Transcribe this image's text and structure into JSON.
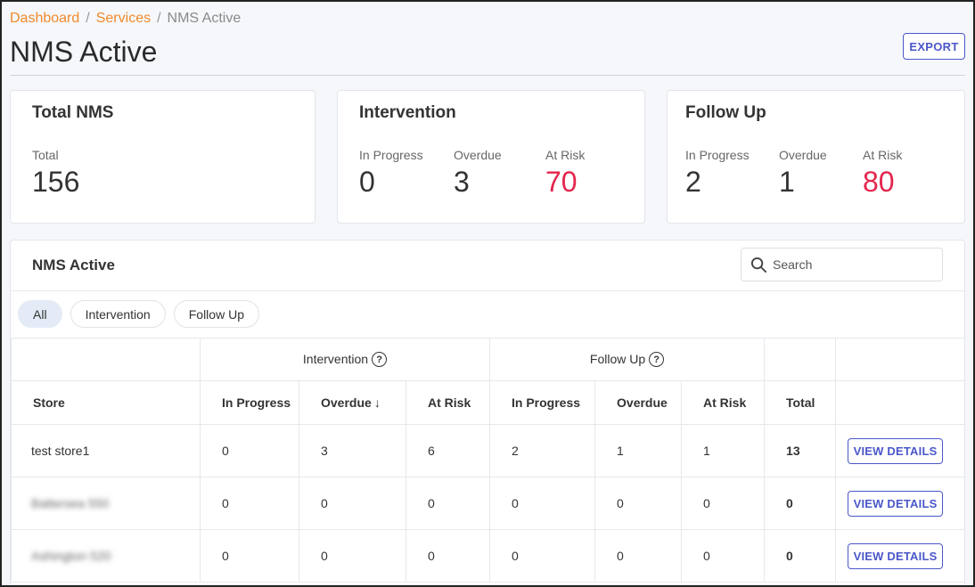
{
  "breadcrumb": {
    "dashboard": "Dashboard",
    "services": "Services",
    "current": "NMS Active",
    "separator": "/"
  },
  "page_title": "NMS Active",
  "export_label": "EXPORT",
  "cards": {
    "total": {
      "title": "Total NMS",
      "label": "Total",
      "value": "156"
    },
    "intervention": {
      "title": "Intervention",
      "in_progress_label": "In Progress",
      "in_progress": "0",
      "overdue_label": "Overdue",
      "overdue": "3",
      "at_risk_label": "At Risk",
      "at_risk": "70"
    },
    "follow_up": {
      "title": "Follow Up",
      "in_progress_label": "In Progress",
      "in_progress": "2",
      "overdue_label": "Overdue",
      "overdue": "1",
      "at_risk_label": "At Risk",
      "at_risk": "80"
    }
  },
  "panel": {
    "title": "NMS Active",
    "search_placeholder": "Search",
    "chips": [
      "All",
      "Intervention",
      "Follow Up"
    ],
    "active_chip": "All"
  },
  "table": {
    "groups": {
      "intervention": "Intervention",
      "follow_up": "Follow Up"
    },
    "columns": {
      "store": "Store",
      "int_in_progress": "In Progress",
      "int_overdue": "Overdue",
      "int_at_risk": "At Risk",
      "fu_in_progress": "In Progress",
      "fu_overdue": "Overdue",
      "fu_at_risk": "At Risk",
      "total": "Total"
    },
    "sort": {
      "column": "int_overdue",
      "direction": "desc"
    },
    "view_label": "VIEW DETAILS",
    "rows": [
      {
        "store": "test store1",
        "int_in_progress": "0",
        "int_overdue": "3",
        "int_at_risk": "6",
        "fu_in_progress": "2",
        "fu_overdue": "1",
        "fu_at_risk": "1",
        "total": "13",
        "blurred": false
      },
      {
        "store": "Battersea 550",
        "int_in_progress": "0",
        "int_overdue": "0",
        "int_at_risk": "0",
        "fu_in_progress": "0",
        "fu_overdue": "0",
        "fu_at_risk": "0",
        "total": "0",
        "blurred": true
      },
      {
        "store": "Ashington 520",
        "int_in_progress": "0",
        "int_overdue": "0",
        "int_at_risk": "0",
        "fu_in_progress": "0",
        "fu_overdue": "0",
        "fu_at_risk": "0",
        "total": "0",
        "blurred": true
      }
    ]
  },
  "colors": {
    "accent": "#4a57c9",
    "breadcrumb_link": "#f0892a",
    "risk": "#e3264d",
    "chip_active": "#e4ebf7"
  },
  "icons": {
    "search": "search-icon",
    "help": "help-circle-icon",
    "sort": "arrow-down-icon"
  }
}
